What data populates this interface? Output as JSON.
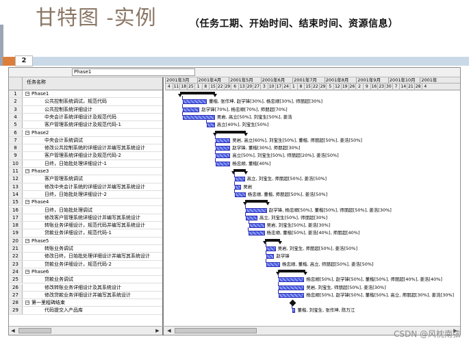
{
  "slide": {
    "title": "甘特图 -实例",
    "subtitle": "（任务工期、开始时间、结束时间、资源信息）",
    "slide_number": "2",
    "accent_color": "#dc7f3c",
    "band_color": "#c9d9e8"
  },
  "entry_bar": {
    "value": "Phase1"
  },
  "table": {
    "header_name": "任务名称",
    "rows": [
      {
        "id": "1",
        "name": "Phase1",
        "level": 0,
        "summary": true
      },
      {
        "id": "2",
        "name": "公共控制系统调试，规范代码",
        "level": 1
      },
      {
        "id": "3",
        "name": "公共控制系统详细设计",
        "level": 1
      },
      {
        "id": "4",
        "name": "中央会计系统详细设计及规范代码",
        "level": 1
      },
      {
        "id": "5",
        "name": "客户管理系统详细设计及规范代码-1",
        "level": 1
      },
      {
        "id": "6",
        "name": "Phase2",
        "level": 0,
        "summary": true
      },
      {
        "id": "7",
        "name": "中央会计系统调试",
        "level": 1
      },
      {
        "id": "8",
        "name": "修改公共控制系统的详细设计并编写其系统设计",
        "level": 1
      },
      {
        "id": "9",
        "name": "客户管理系统详细设计及规范代码-2",
        "level": 1
      },
      {
        "id": "10",
        "name": "日终，日始批处理详细设计-1",
        "level": 1
      },
      {
        "id": "11",
        "name": "Phase3",
        "level": 0,
        "summary": true
      },
      {
        "id": "12",
        "name": "客户管理系统调试",
        "level": 1
      },
      {
        "id": "13",
        "name": "修改中央会计系统的详细设计并编写其系统设计",
        "level": 1
      },
      {
        "id": "14",
        "name": "日终，日始批处理详细设计-2",
        "level": 1
      },
      {
        "id": "15",
        "name": "Phase4",
        "level": 0,
        "summary": true
      },
      {
        "id": "16",
        "name": "日终，日始批处理调试",
        "level": 1
      },
      {
        "id": "17",
        "name": "修改客户管理系统详细设计并编写其系统设计",
        "level": 1
      },
      {
        "id": "18",
        "name": "转账业务详细设计，规范代码并编写其系统设计",
        "level": 1
      },
      {
        "id": "19",
        "name": "贷款业务详细设计，规范代码-1",
        "level": 1
      },
      {
        "id": "20",
        "name": "Phase5",
        "level": 0,
        "summary": true
      },
      {
        "id": "21",
        "name": "转账业务调试",
        "level": 1
      },
      {
        "id": "22",
        "name": "修改日终，日始批处理详细设计并编写其系统设计",
        "level": 1
      },
      {
        "id": "23",
        "name": "贷款业务详细设计，规范代码-2",
        "level": 1
      },
      {
        "id": "24",
        "name": "Phase6",
        "level": 0,
        "summary": true
      },
      {
        "id": "25",
        "name": "贷款业务调试",
        "level": 1
      },
      {
        "id": "26",
        "name": "修改转账业务详细设计及其系统设计",
        "level": 1
      },
      {
        "id": "27",
        "name": "修改贷款业务详细设计并编写其系统设计",
        "level": 1
      },
      {
        "id": "28",
        "name": "第一里程碑结束",
        "level": 0,
        "summary": true
      },
      {
        "id": "29",
        "name": "代码提交入产品库",
        "level": 1
      }
    ]
  },
  "timeline": {
    "months": [
      "2001年3月",
      "2001年4月",
      "2001年5月",
      "2001年6月",
      "2001年7月",
      "2001年8月",
      "2001年9月",
      "2001年10月",
      "2001年"
    ],
    "days": [
      "4",
      "11",
      "18",
      "25",
      "1",
      "8",
      "15",
      "22",
      "29",
      "6",
      "13",
      "20",
      "27",
      "3",
      "10",
      "17",
      "24",
      "1",
      "8",
      "15",
      "22",
      "29",
      "5",
      "12",
      "19",
      "26",
      "2",
      "9",
      "16",
      "23",
      "30",
      "7",
      "14",
      "21",
      "28",
      "4"
    ]
  },
  "tasks": [
    {
      "row": 1,
      "type": "summary",
      "start": 2.1,
      "end": 6.8,
      "label": ""
    },
    {
      "row": 2,
      "type": "task",
      "start": 2.4,
      "end": 5.7,
      "label": "董楷, 张作坤, 赵学锋[30%], 杨忠顺[30%], 师朋超[30%]"
    },
    {
      "row": 3,
      "type": "task",
      "start": 2.4,
      "end": 4.7,
      "label": "赵学锋[70%], 杨忠顺[70%], 师朋超[70%]"
    },
    {
      "row": 4,
      "type": "task",
      "start": 2.4,
      "end": 6.8,
      "label": "吴岩, 高立[50%], 刘宝生[50%], 姜浩"
    },
    {
      "row": 5,
      "type": "task",
      "start": 5.7,
      "end": 6.8,
      "label": "高立[40%], 刘宝生[50%]"
    },
    {
      "row": 6,
      "type": "summary",
      "start": 6.8,
      "end": 11.0,
      "label": ""
    },
    {
      "row": 7,
      "type": "task",
      "start": 6.9,
      "end": 8.9,
      "label": "吴岩, 高立[60%], 刘宝生[50%], 董楷, 师朋超[50%], 姜浩[50%]"
    },
    {
      "row": 8,
      "type": "task",
      "start": 6.9,
      "end": 8.9,
      "label": "赵学锋, 董楷[30%], 师朋超[30%]"
    },
    {
      "row": 9,
      "type": "task",
      "start": 6.9,
      "end": 8.9,
      "label": "高立[50%], 刘宝生[50%], 师朋超[20%], 姜浩[50%]"
    },
    {
      "row": 10,
      "type": "task",
      "start": 6.9,
      "end": 8.9,
      "label": "杨忠顺, 董楷[40%]"
    },
    {
      "row": 11,
      "type": "summary",
      "start": 9.3,
      "end": 11.0,
      "label": ""
    },
    {
      "row": 12,
      "type": "task",
      "start": 9.5,
      "end": 10.9,
      "label": "高立, 刘宝生, 师朋超[50%], 姜浩[50%]"
    },
    {
      "row": 13,
      "type": "task",
      "start": 9.5,
      "end": 10.4,
      "label": "吴岩"
    },
    {
      "row": 14,
      "type": "task",
      "start": 9.5,
      "end": 11.0,
      "label": "杨忠顺, 董楷, 师朋超[50%], 姜浩[50%]"
    },
    {
      "row": 15,
      "type": "summary",
      "start": 10.9,
      "end": 14.0,
      "label": ""
    },
    {
      "row": 16,
      "type": "task",
      "start": 11.0,
      "end": 13.9,
      "label": "赵学锋, 杨忠顺[50%], 董楷[50%], 师朋超[50%], 姜浩[30%]"
    },
    {
      "row": 17,
      "type": "task",
      "start": 11.0,
      "end": 12.6,
      "label": "高立, 刘宝生[50%], 师朋超[30%]"
    },
    {
      "row": 18,
      "type": "task",
      "start": 11.5,
      "end": 13.6,
      "label": "吴岩, 刘宝生[50%], 姜浩[30%]"
    },
    {
      "row": 19,
      "type": "task",
      "start": 11.4,
      "end": 13.6,
      "label": "杨忠顺, 董楷[50%], 姜浩[40%], 师朋超[40%]"
    },
    {
      "row": 20,
      "type": "summary",
      "start": 13.6,
      "end": 15.7,
      "label": ""
    },
    {
      "row": 21,
      "type": "task",
      "start": 13.8,
      "end": 15.1,
      "label": "吴岩, 刘宝生, 师朋超[50%], 姜浩[50%]"
    },
    {
      "row": 22,
      "type": "task",
      "start": 13.8,
      "end": 14.9,
      "label": "赵学锋"
    },
    {
      "row": 23,
      "type": "task",
      "start": 13.8,
      "end": 15.7,
      "label": "杨忠顺, 董楷, 高立, 师朋超[50%], 姜浩[50%]"
    },
    {
      "row": 24,
      "type": "summary",
      "start": 15.4,
      "end": 19.2,
      "label": ""
    },
    {
      "row": 25,
      "type": "task",
      "start": 15.5,
      "end": 19.0,
      "label": "杨忠顺[50%], 赵学锋[50%], 董楷[50%], 师朋超[40%], 姜浩[40%]"
    },
    {
      "row": 26,
      "type": "task",
      "start": 15.5,
      "end": 19.0,
      "label": "吴岩, 刘宝生, 师朋超[50%], 姜浩[30%]"
    },
    {
      "row": 27,
      "type": "task",
      "start": 15.5,
      "end": 19.0,
      "label": "杨忠顺[50%], 赵学锋[50%], 董楷[50%], 高立, 师朋超[30%], 姜浩[30%]"
    },
    {
      "row": 28,
      "type": "milestone",
      "start": 17.4,
      "end": 17.4,
      "label": ""
    },
    {
      "row": 29,
      "type": "task",
      "start": 17.4,
      "end": 17.8,
      "label": "董楷, 刘宝生, 张作坤, 陈万江"
    }
  ],
  "watermark": "CSDN @风枕南弦"
}
